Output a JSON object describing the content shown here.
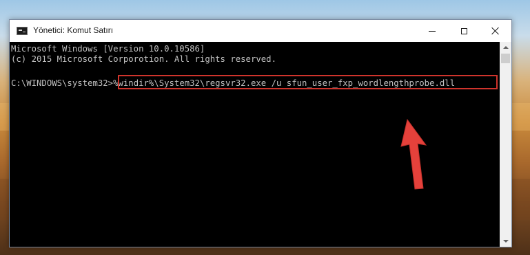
{
  "window": {
    "title": "Yönetici: Komut Satırı",
    "icon": "cmd-icon",
    "controls": [
      "minimize-icon",
      "maximize-icon",
      "close-icon"
    ]
  },
  "console": {
    "line1": "Microsoft Windows [Version 10.0.10586]",
    "line2": "(c) 2015 Microsoft Corporotion. All rights reserved.",
    "prompt": "C:\\WINDOWS\\system32>",
    "command": "%windir%\\System32\\regsvr32.exe /u sfun_user_fxp_wordlengthprobe.dll"
  },
  "annotation": {
    "highlight_color": "#d0342c",
    "arrow_color": "#e5413b"
  }
}
